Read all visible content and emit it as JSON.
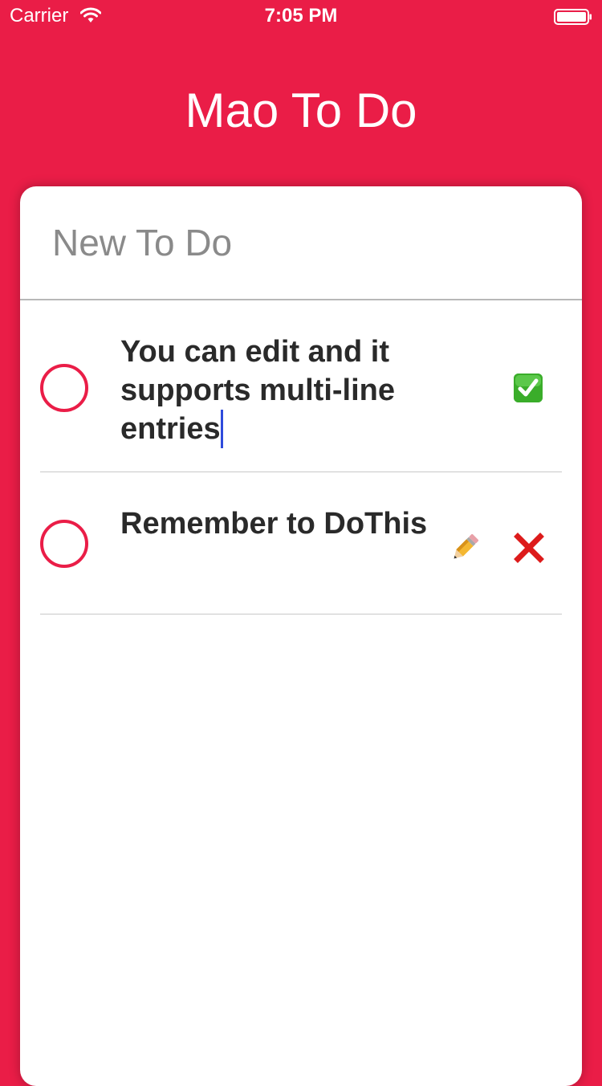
{
  "status_bar": {
    "carrier": "Carrier",
    "time": "7:05 PM",
    "icons": [
      "wifi-icon",
      "battery-icon"
    ]
  },
  "header": {
    "title": "Mao To Do"
  },
  "new_todo": {
    "placeholder": "New To Do",
    "value": ""
  },
  "todos": [
    {
      "text": "You can edit and it supports multi-line entries",
      "editing": true,
      "actions": [
        "done-check-icon"
      ]
    },
    {
      "text": "Remember to DoThis",
      "editing": false,
      "actions": [
        "pencil-icon",
        "delete-x-icon"
      ]
    }
  ],
  "colors": {
    "brand": "#ea1d47",
    "card": "#ffffff",
    "text": "#2a2a2a",
    "placeholder": "#8a8a8a",
    "caret": "#2f4bdc",
    "check": "#3aad2a"
  }
}
